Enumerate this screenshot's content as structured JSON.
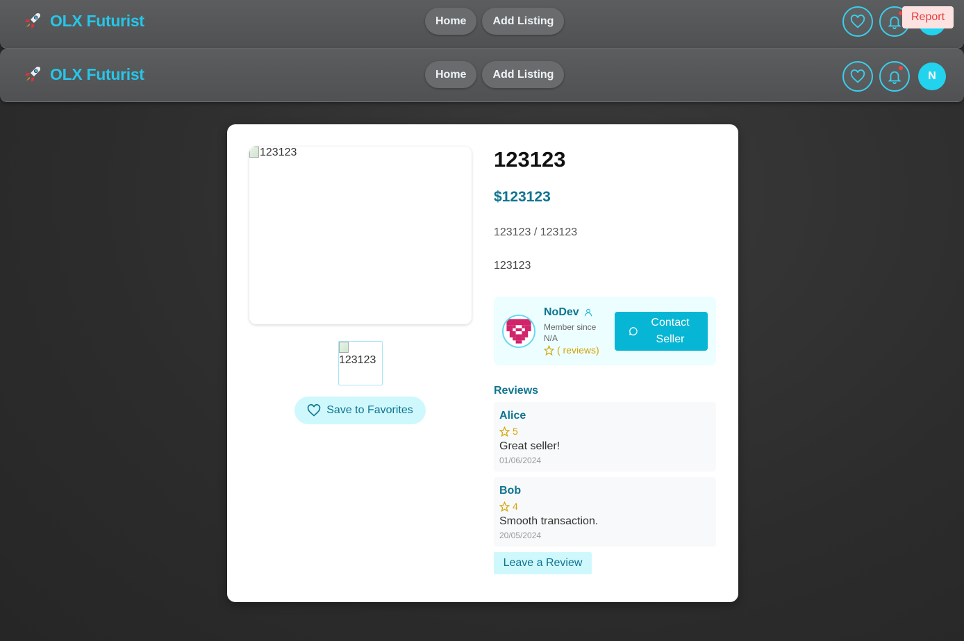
{
  "navbar": {
    "brand": "OLX Futurist",
    "links": [
      "Home",
      "Add Listing"
    ],
    "avatar_initial": "N",
    "report_label": "Report"
  },
  "listing": {
    "image_alt": "123123",
    "thumb_alt": "123123",
    "title": "123123",
    "price": "$123123",
    "location": "123123 / 123123",
    "description": "123123",
    "save_label": "Save to Favorites"
  },
  "seller": {
    "name": "NoDev",
    "member_since": "Member since N/A",
    "reviews_text": "( reviews)",
    "contact_label": "Contact Seller"
  },
  "reviews": {
    "title": "Reviews",
    "items": [
      {
        "name": "Alice",
        "rating": "5",
        "text": "Great seller!",
        "date": "01/06/2024"
      },
      {
        "name": "Bob",
        "rating": "4",
        "text": "Smooth transaction.",
        "date": "20/05/2024"
      }
    ],
    "leave_label": "Leave a Review"
  },
  "colors": {
    "accent": "#22d3ee",
    "teal_text": "#0e7490",
    "star": "#d4a50a",
    "report_bg": "#fde2e2",
    "report_text": "#e33d3d"
  }
}
